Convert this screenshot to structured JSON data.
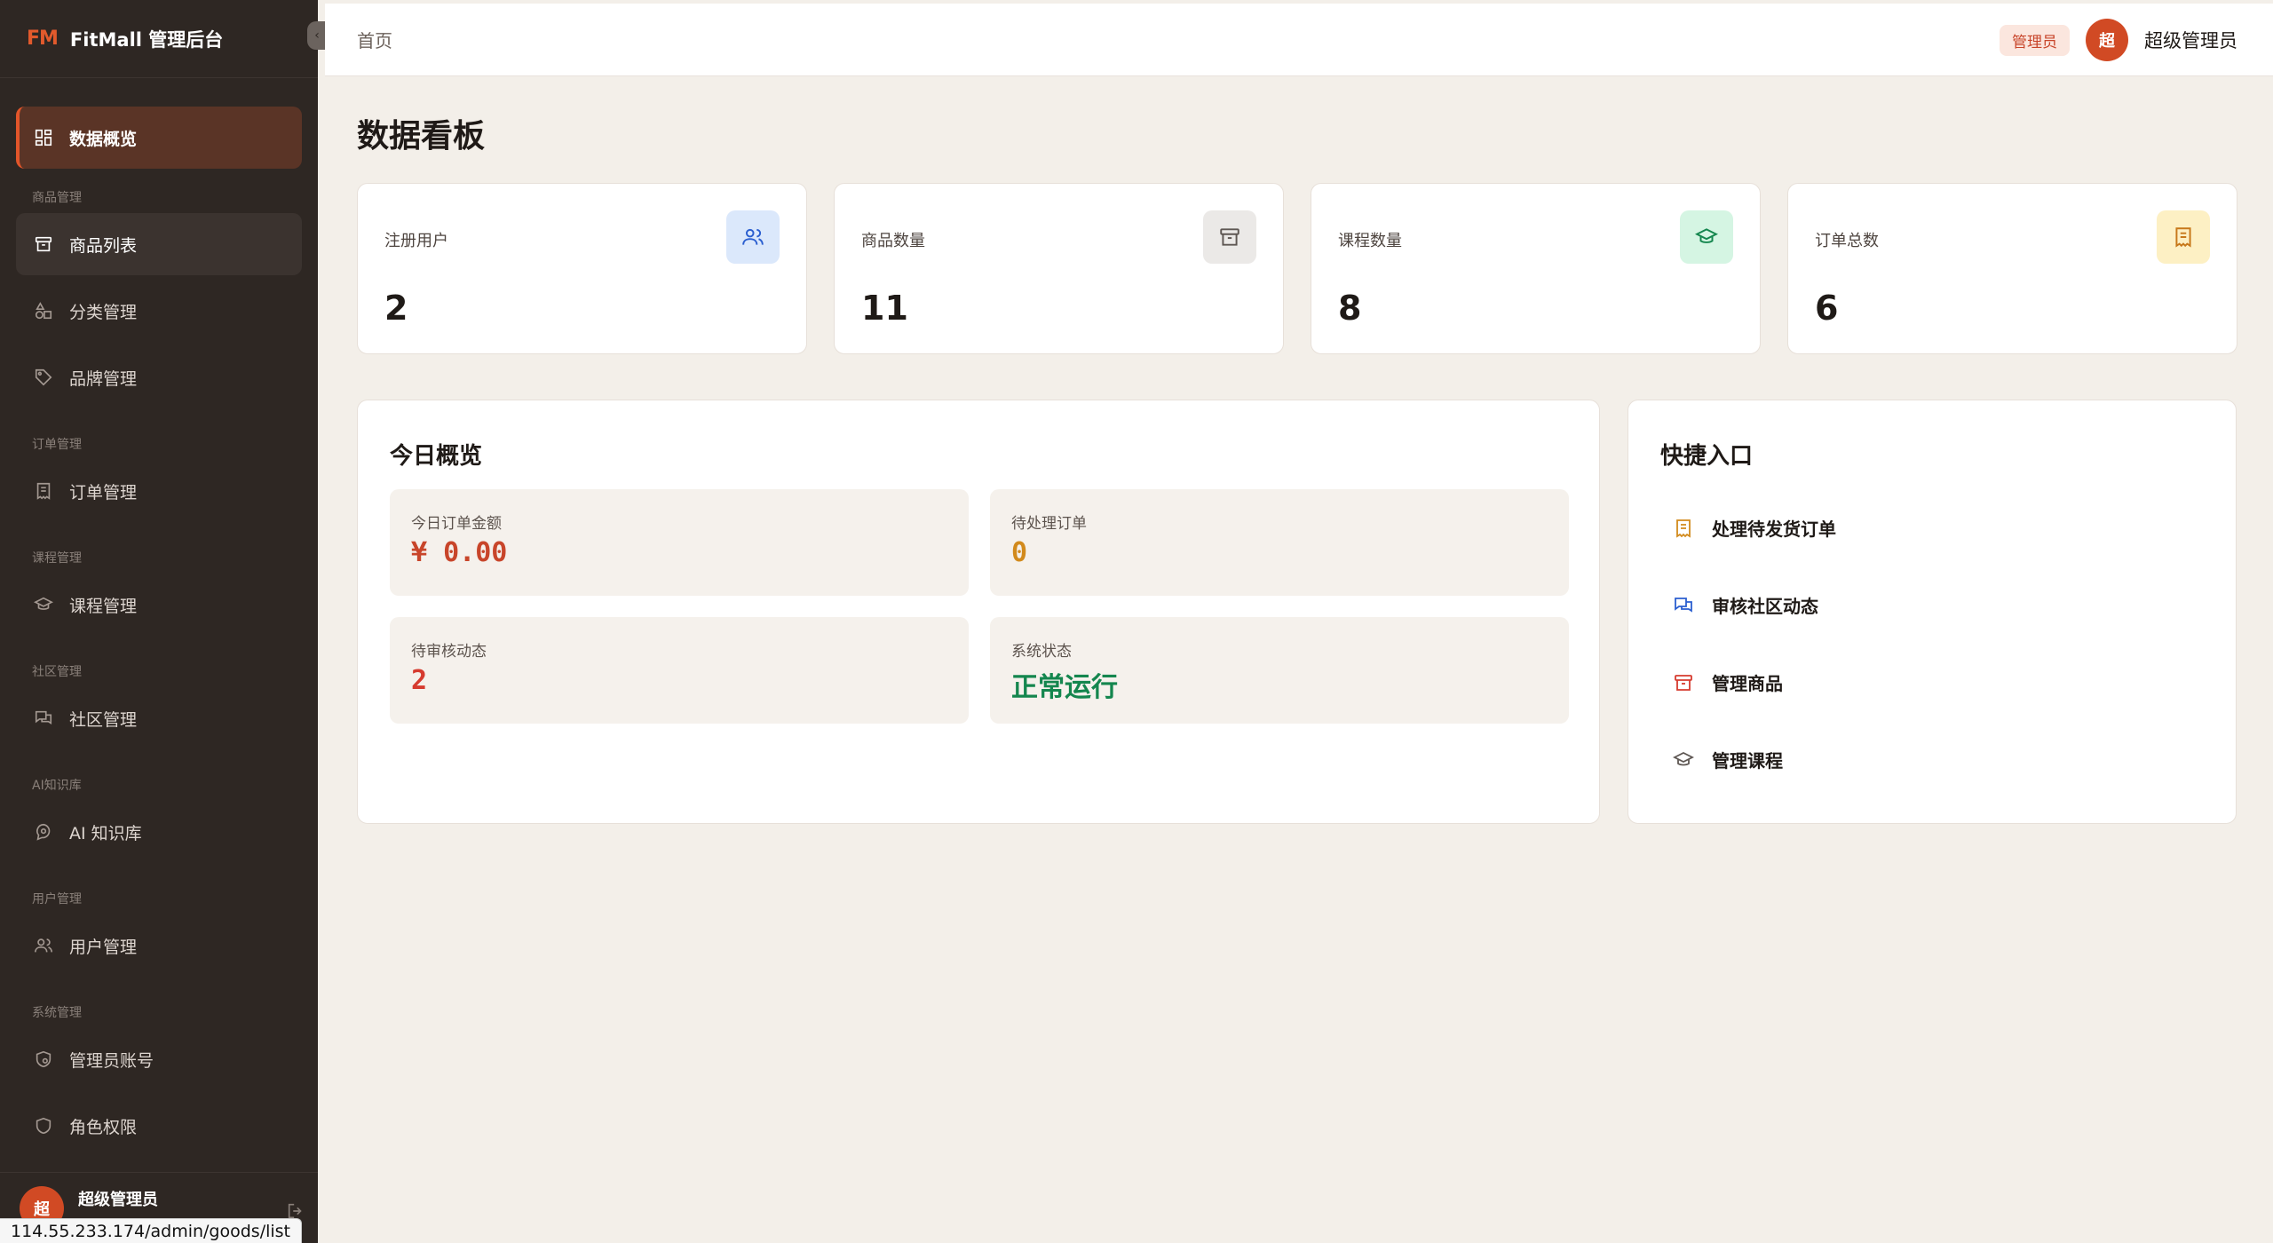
{
  "sidebar": {
    "brand_logo": "FM",
    "brand_title": "FitMall 管理后台",
    "collapse_icon": "‹",
    "overview": "数据概览",
    "groups": {
      "goods": "商品管理",
      "orders": "订单管理",
      "courses": "课程管理",
      "community": "社区管理",
      "ai": "AI知识库",
      "users": "用户管理",
      "system": "系统管理"
    },
    "items": {
      "goods_list": "商品列表",
      "category": "分类管理",
      "brand": "品牌管理",
      "orders": "订单管理",
      "courses": "课程管理",
      "community": "社区管理",
      "ai_kb": "AI 知识库",
      "users": "用户管理",
      "admins": "管理员账号",
      "roles": "角色权限"
    },
    "footer": {
      "avatar_text": "超",
      "name": "超级管理员"
    },
    "status_url": "114.55.233.174/admin/goods/list"
  },
  "header": {
    "breadcrumb": "首页",
    "role_badge": "管理员",
    "avatar_text": "超",
    "user_name": "超级管理员"
  },
  "page": {
    "title": "数据看板"
  },
  "stats": [
    {
      "label": "注册用户",
      "value": "2",
      "icon": "users-icon",
      "bg": "#dbe8fb",
      "color": "#2b5fd0"
    },
    {
      "label": "商品数量",
      "value": "11",
      "icon": "archive-icon",
      "bg": "#ebe9e7",
      "color": "#5e5753"
    },
    {
      "label": "课程数量",
      "value": "8",
      "icon": "graduation-cap-icon",
      "bg": "#d5f5e3",
      "color": "#14864e"
    },
    {
      "label": "订单总数",
      "value": "6",
      "icon": "receipt-icon",
      "bg": "#fdf0c4",
      "color": "#c7781a"
    }
  ],
  "today": {
    "title": "今日概览",
    "cells": [
      {
        "label": "今日订单金额",
        "value": "¥ 0.00",
        "color": "#c8452a"
      },
      {
        "label": "待处理订单",
        "value": "0",
        "color": "#d28a1c"
      },
      {
        "label": "待审核动态",
        "value": "2",
        "color": "#d63b2f"
      },
      {
        "label": "系统状态",
        "value": "正常运行",
        "color": "#14864e"
      }
    ]
  },
  "quick": {
    "title": "快捷入口",
    "items": [
      {
        "label": "处理待发货订单",
        "icon": "receipt-icon",
        "color": "#d28a1c"
      },
      {
        "label": "审核社区动态",
        "icon": "chat-icon",
        "color": "#2b5fd0"
      },
      {
        "label": "管理商品",
        "icon": "archive-icon",
        "color": "#d63b2f"
      },
      {
        "label": "管理课程",
        "icon": "graduation-cap-icon",
        "color": "#5e5753"
      }
    ]
  }
}
